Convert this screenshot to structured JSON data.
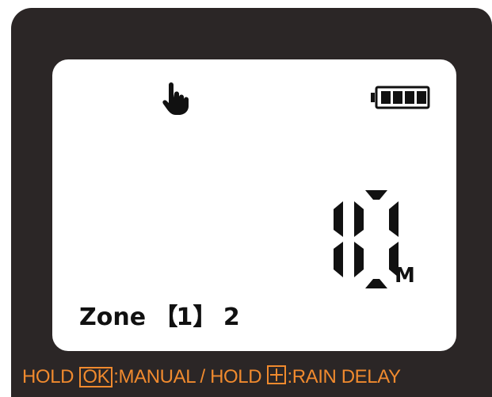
{
  "display": {
    "duration_value": "10",
    "duration_unit": "M",
    "zone_label": "Zone",
    "zone_bracket_open": "【",
    "zone_selected": "1",
    "zone_bracket_close": "】",
    "zone_next": "2",
    "battery_level": 4,
    "battery_segments": 4,
    "mode_icon": "hand-pointer-icon"
  },
  "footer": {
    "hold_1": "HOLD",
    "ok_key": "OK",
    "manual_label": ":MANUAL / HOLD",
    "plus_key_icon": "plus-key-icon",
    "rain_delay_label": ":RAIN DELAY"
  },
  "colors": {
    "device_body": "#2b2626",
    "lcd_background": "#ffffff",
    "segment": "#111111",
    "footer_text": "#f08a2e"
  }
}
